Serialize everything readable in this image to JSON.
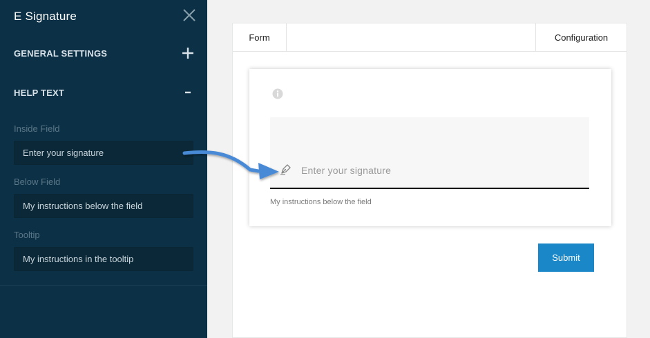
{
  "sidebar": {
    "title": "E Signature",
    "sections": [
      {
        "label": "GENERAL SETTINGS",
        "icon": "plus-icon"
      },
      {
        "label": "HELP TEXT",
        "icon": "minus-icon"
      }
    ],
    "fields": {
      "inside": {
        "label": "Inside Field",
        "value": "Enter your signature"
      },
      "below": {
        "label": "Below Field",
        "value": "My instructions below the field"
      },
      "tooltip": {
        "label": "Tooltip",
        "value": "My instructions in the tooltip"
      }
    }
  },
  "main": {
    "tabs": {
      "form": "Form",
      "configuration": "Configuration"
    },
    "signature": {
      "placeholder": "Enter your signature",
      "below_text": "My instructions below the field"
    },
    "submit_label": "Submit"
  },
  "colors": {
    "sidebar_bg": "#0c3147",
    "accent": "#1a87c9",
    "arrow": "#4a8ad6"
  }
}
